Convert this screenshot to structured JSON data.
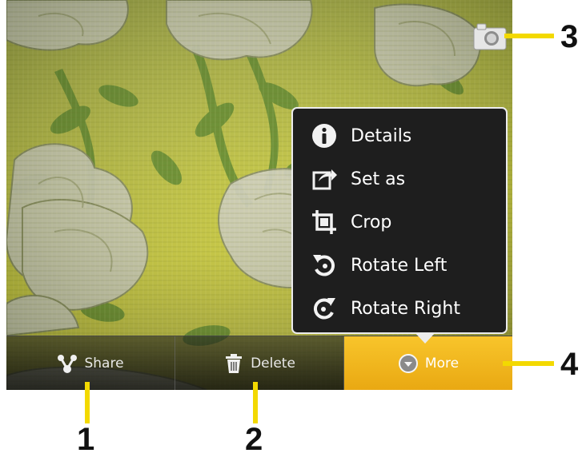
{
  "menu": {
    "items": [
      {
        "label": "Details",
        "icon": "info-icon"
      },
      {
        "label": "Set as",
        "icon": "set-as-icon"
      },
      {
        "label": "Crop",
        "icon": "crop-icon"
      },
      {
        "label": "Rotate Left",
        "icon": "rotate-left-icon"
      },
      {
        "label": "Rotate Right",
        "icon": "rotate-right-icon"
      }
    ]
  },
  "action_bar": {
    "share_label": "Share",
    "delete_label": "Delete",
    "more_label": "More"
  },
  "camera": {
    "icon": "camera-icon"
  },
  "callouts": {
    "one": "1",
    "two": "2",
    "three": "3",
    "four": "4"
  },
  "colors": {
    "accent": "#f3d900",
    "active_button": "#f2b71f",
    "menu_background": "#1e1e1e"
  }
}
